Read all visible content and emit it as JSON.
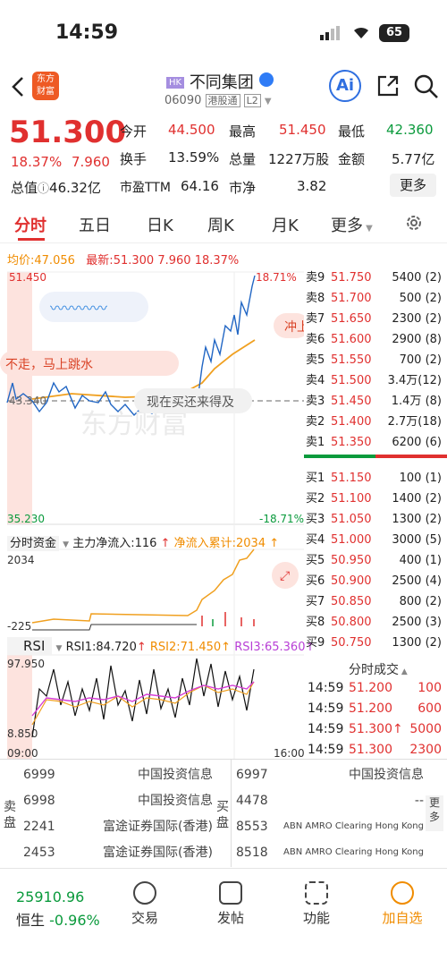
{
  "status": {
    "time": "14:59",
    "battery": "65"
  },
  "nav": {
    "logo_line1": "东方",
    "logo_line2": "财富",
    "hk": "HK",
    "name": "不同集团",
    "code": "06090",
    "tag1": "港股通",
    "tag2": "L2",
    "ai": "Ai"
  },
  "quote": {
    "price": "51.300",
    "pct": "18.37%",
    "chg": "7.960",
    "open_l": "今开",
    "open": "44.500",
    "high_l": "最高",
    "high": "51.450",
    "low_l": "最低",
    "low": "42.360",
    "turn_l": "换手",
    "turn": "13.59%",
    "vol_l": "总量",
    "vol": "1227万股",
    "amt_l": "金额",
    "amt": "5.77亿",
    "cap_l": "总值",
    "cap": "46.32亿",
    "pe_l": "市盈TTM",
    "pe": "64.16",
    "pb_l": "市净",
    "pb": "3.82",
    "more": "更多"
  },
  "tabs": [
    "分时",
    "五日",
    "日K",
    "周K",
    "月K",
    "更多"
  ],
  "avgline": {
    "avg_l": "均价:",
    "avg": "47.056",
    "new_l": "最新:",
    "new": "51.300",
    "chg": "7.960",
    "pct": "18.37%"
  },
  "chart": {
    "ymax": "51.450",
    "ymin": "35.230",
    "pmax": "18.71%",
    "pmin": "-18.71%",
    "ref": "43.340",
    "bubble1": "不走，马上跳水",
    "bubble2": "现在买还来得及",
    "bubble3": "冲上",
    "wm": "东方财富"
  },
  "flow": {
    "label": "分时资金",
    "main": "主力净流入:116",
    "acc": "净流入累计:2034",
    "top": "2034",
    "bottom": "-225"
  },
  "rsi": {
    "label": "RSI",
    "r1": "RSI1:84.720",
    "r2": "RSI2:71.450",
    "r3": "RSI3:65.360",
    "top": "97.950",
    "bottom": "8.850",
    "t0": "09:00",
    "t1": "16:00"
  },
  "asks": [
    {
      "l": "卖9",
      "p": "51.750",
      "v": "5400 (2)"
    },
    {
      "l": "卖8",
      "p": "51.700",
      "v": "500 (2)"
    },
    {
      "l": "卖7",
      "p": "51.650",
      "v": "2300 (2)"
    },
    {
      "l": "卖6",
      "p": "51.600",
      "v": "2900 (8)"
    },
    {
      "l": "卖5",
      "p": "51.550",
      "v": "700 (2)"
    },
    {
      "l": "卖4",
      "p": "51.500",
      "v": "3.4万(12)"
    },
    {
      "l": "卖3",
      "p": "51.450",
      "v": "1.4万 (8)"
    },
    {
      "l": "卖2",
      "p": "51.400",
      "v": "2.7万(18)"
    },
    {
      "l": "卖1",
      "p": "51.350",
      "v": "6200 (6)"
    }
  ],
  "bids": [
    {
      "l": "买1",
      "p": "51.150",
      "v": "100 (1)"
    },
    {
      "l": "买2",
      "p": "51.100",
      "v": "1400 (2)"
    },
    {
      "l": "买3",
      "p": "51.050",
      "v": "1300 (2)"
    },
    {
      "l": "买4",
      "p": "51.000",
      "v": "3000 (5)"
    },
    {
      "l": "买5",
      "p": "50.950",
      "v": "400 (1)"
    },
    {
      "l": "买6",
      "p": "50.900",
      "v": "2500 (4)"
    },
    {
      "l": "买7",
      "p": "50.850",
      "v": "800 (2)"
    },
    {
      "l": "买8",
      "p": "50.800",
      "v": "2500 (3)"
    },
    {
      "l": "买9",
      "p": "50.750",
      "v": "1300 (2)"
    }
  ],
  "ticks": {
    "title": "分时成交",
    "rows": [
      {
        "t": "14:59",
        "p": "51.200",
        "v": "100"
      },
      {
        "t": "14:59",
        "p": "51.200",
        "v": "600"
      },
      {
        "t": "14:59",
        "p": "51.300↑",
        "v": "5000"
      },
      {
        "t": "14:59",
        "p": "51.300",
        "v": "2300"
      }
    ]
  },
  "broker": {
    "sell": "卖盘",
    "buy": "买盘",
    "more": "更多",
    "left": [
      {
        "c": "6999",
        "n": "中国投资信息"
      },
      {
        "c": "6998",
        "n": "中国投资信息"
      },
      {
        "c": "2241",
        "n": "富途证券国际(香港)"
      },
      {
        "c": "2453",
        "n": "富途证券国际(香港)"
      }
    ],
    "right": [
      {
        "c": "6997",
        "n": "中国投资信息"
      },
      {
        "c": "4478",
        "n": "--"
      },
      {
        "c": "8553",
        "n": "ABN AMRO Clearing Hong Kong"
      },
      {
        "c": "8518",
        "n": "ABN AMRO Clearing Hong Kong"
      }
    ]
  },
  "bottom": {
    "index": "25910.96",
    "idxname": "恒生",
    "idxpct": "-0.96%",
    "items": [
      "交易",
      "发帖",
      "功能",
      "加自选"
    ]
  },
  "colors": {
    "up": "#e0302f",
    "down": "#0a9a3c",
    "accent": "#f08c00",
    "line": "#1d63c8"
  }
}
